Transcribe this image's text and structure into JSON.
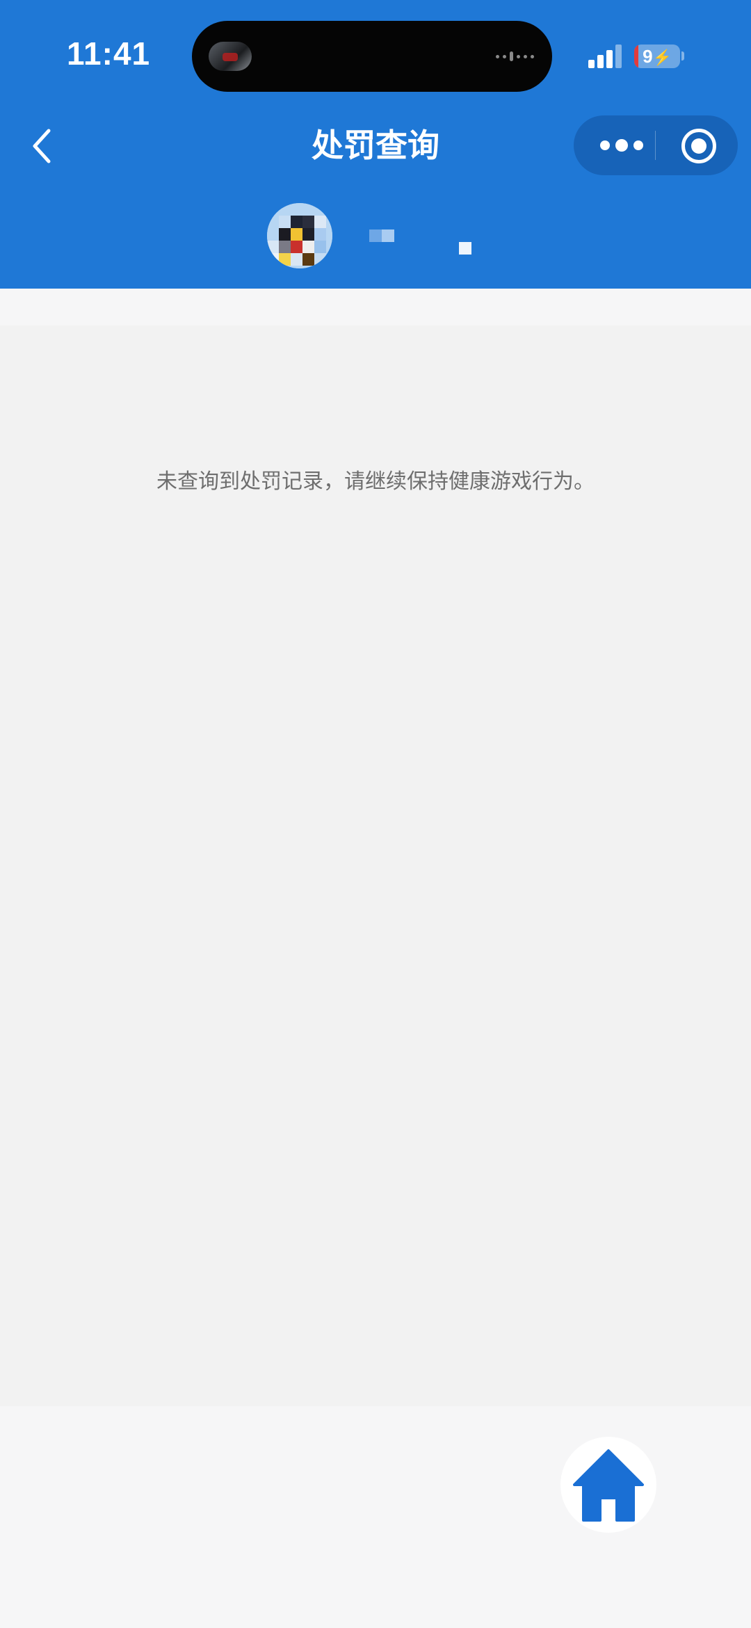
{
  "status_bar": {
    "time": "11:41",
    "battery_level": "9",
    "charging": true,
    "island_thumbnail_icon": "game-thumbnail-icon",
    "signal_icon": "cellular-signal-icon"
  },
  "nav": {
    "back_icon": "chevron-left-icon",
    "title": "处罚查询",
    "more_icon": "more-dots-icon",
    "close_icon": "miniprogram-close-icon"
  },
  "profile": {
    "avatar_icon": "user-avatar",
    "name_obscured": true
  },
  "content": {
    "empty_message": "未查询到处罚记录，请继续保持健康游戏行为。"
  },
  "floating": {
    "home_icon": "home-icon"
  },
  "colors": {
    "header_bg": "#1f78d6",
    "page_bg": "#f2f2f2",
    "footer_bg": "#f6f6f7",
    "accent": "#1a6fd4",
    "message_text": "#6e6e6e"
  }
}
